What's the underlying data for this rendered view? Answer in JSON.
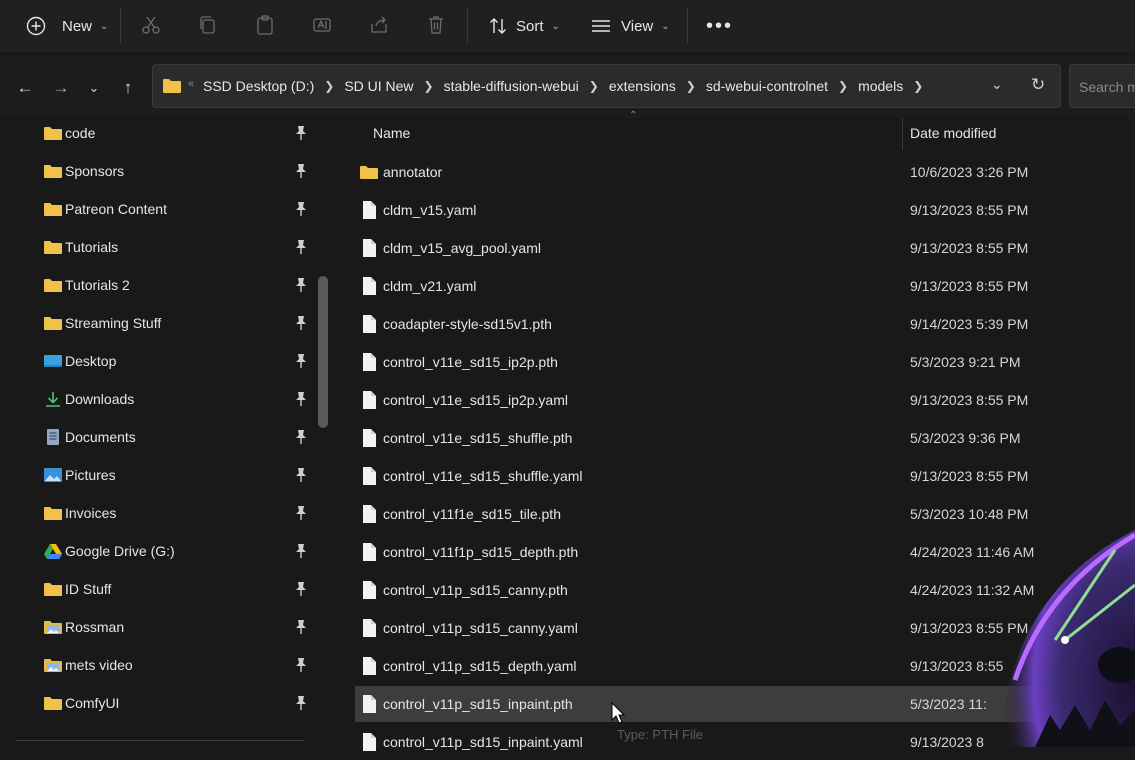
{
  "toolbar": {
    "new_label": "New",
    "sort_label": "Sort",
    "view_label": "View"
  },
  "address_bar": {
    "breadcrumbs": [
      "SSD Desktop (D:)",
      "SD UI New",
      "stable-diffusion-webui",
      "extensions",
      "sd-webui-controlnet",
      "models"
    ],
    "search_placeholder": "Search m"
  },
  "sidebar": {
    "items": [
      {
        "label": "code",
        "icon": "folder-icon"
      },
      {
        "label": "Sponsors",
        "icon": "folder-icon"
      },
      {
        "label": "Patreon Content",
        "icon": "folder-icon"
      },
      {
        "label": "Tutorials",
        "icon": "folder-icon"
      },
      {
        "label": "Tutorials 2",
        "icon": "folder-icon"
      },
      {
        "label": "Streaming Stuff",
        "icon": "folder-icon"
      },
      {
        "label": "Desktop",
        "icon": "desktop-icon"
      },
      {
        "label": "Downloads",
        "icon": "download-icon"
      },
      {
        "label": "Documents",
        "icon": "documents-icon"
      },
      {
        "label": "Pictures",
        "icon": "pictures-icon"
      },
      {
        "label": "Invoices",
        "icon": "folder-icon"
      },
      {
        "label": "Google Drive (G:)",
        "icon": "google-drive-icon"
      },
      {
        "label": "ID Stuff",
        "icon": "folder-icon"
      },
      {
        "label": "Rossman",
        "icon": "image-folder-icon"
      },
      {
        "label": "mets video",
        "icon": "image-folder-icon"
      },
      {
        "label": "ComfyUI",
        "icon": "folder-icon"
      }
    ]
  },
  "file_list": {
    "columns": {
      "name": "Name",
      "date_modified": "Date modified"
    },
    "rows": [
      {
        "name": "annotator",
        "date": "10/6/2023 3:26 PM",
        "type": "folder"
      },
      {
        "name": "cldm_v15.yaml",
        "date": "9/13/2023 8:55 PM",
        "type": "file"
      },
      {
        "name": "cldm_v15_avg_pool.yaml",
        "date": "9/13/2023 8:55 PM",
        "type": "file"
      },
      {
        "name": "cldm_v21.yaml",
        "date": "9/13/2023 8:55 PM",
        "type": "file"
      },
      {
        "name": "coadapter-style-sd15v1.pth",
        "date": "9/14/2023 5:39 PM",
        "type": "file"
      },
      {
        "name": "control_v11e_sd15_ip2p.pth",
        "date": "5/3/2023 9:21 PM",
        "type": "file"
      },
      {
        "name": "control_v11e_sd15_ip2p.yaml",
        "date": "9/13/2023 8:55 PM",
        "type": "file"
      },
      {
        "name": "control_v11e_sd15_shuffle.pth",
        "date": "5/3/2023 9:36 PM",
        "type": "file"
      },
      {
        "name": "control_v11e_sd15_shuffle.yaml",
        "date": "9/13/2023 8:55 PM",
        "type": "file"
      },
      {
        "name": "control_v11f1e_sd15_tile.pth",
        "date": "5/3/2023 10:48 PM",
        "type": "file"
      },
      {
        "name": "control_v11f1p_sd15_depth.pth",
        "date": "4/24/2023 11:46 AM",
        "type": "file"
      },
      {
        "name": "control_v11p_sd15_canny.pth",
        "date": "4/24/2023 11:32 AM",
        "type": "file"
      },
      {
        "name": "control_v11p_sd15_canny.yaml",
        "date": "9/13/2023 8:55 PM",
        "type": "file"
      },
      {
        "name": "control_v11p_sd15_depth.yaml",
        "date": "9/13/2023 8:55",
        "type": "file"
      },
      {
        "name": "control_v11p_sd15_inpaint.pth",
        "date": "5/3/2023 11:",
        "type": "file",
        "selected": true
      },
      {
        "name": "control_v11p_sd15_inpaint.yaml",
        "date": "9/13/2023 8",
        "type": "file"
      }
    ],
    "tooltip": "Type: PTH File"
  },
  "colors": {
    "background": "#191919",
    "toolbar": "#202020",
    "folder": "#f0c24a",
    "selected_row": "#3d3d3d"
  }
}
